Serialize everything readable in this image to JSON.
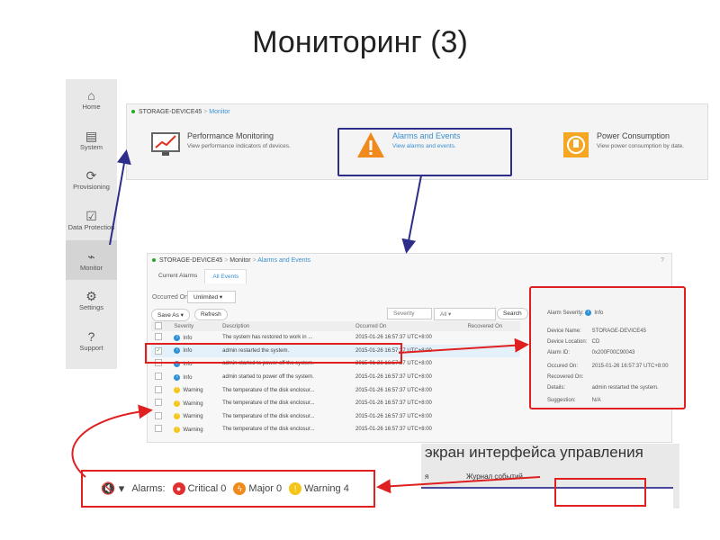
{
  "slide": {
    "title": "Мониторинг (3)"
  },
  "sidebar": {
    "items": [
      {
        "label": "Home",
        "icon": "⌂"
      },
      {
        "label": "System",
        "icon": "▤"
      },
      {
        "label": "Provisioning",
        "icon": "⟳"
      },
      {
        "label": "Data Protection",
        "icon": "☑"
      },
      {
        "label": "Monitor",
        "icon": "⌁"
      },
      {
        "label": "Settings",
        "icon": "⚙"
      },
      {
        "label": "Support",
        "icon": "?"
      }
    ]
  },
  "monitor": {
    "breadcrumb": {
      "device": "STORAGE-DEVICE45",
      "sep": ">",
      "current": "Monitor"
    },
    "cards": [
      {
        "title": "Performance Monitoring",
        "subtitle": "View performance indicators of devices."
      },
      {
        "title": "Alarms and Events",
        "subtitle": "View alarms and events."
      },
      {
        "title": "Power Consumption",
        "subtitle": "View power consumption by date."
      }
    ]
  },
  "events": {
    "breadcrumb": {
      "device": "STORAGE-DEVICE45",
      "monitor": "Monitor",
      "current": "Alarms and Events",
      "sep": ">"
    },
    "help": "?",
    "tabs": [
      "Current Alarms",
      "All Events"
    ],
    "occurred_label": "Occurred On:",
    "occurred_value": "Unlimited",
    "save_as": "Save As ▾",
    "refresh": "Refresh",
    "severity_label": "Severity",
    "severity_value": "All",
    "search": "Search",
    "columns": [
      "Severity",
      "Description",
      "Occurred On",
      "Recovered On"
    ],
    "rows": [
      {
        "severity": "Info",
        "description": "The system has restored to work in ...",
        "occurred": "2015-01-26 16:57:37 UTC+8:00",
        "checked": false
      },
      {
        "severity": "Info",
        "description": "admin restarted the system.",
        "occurred": "2015-01-26 16:57:37 UTC+8:00",
        "checked": true
      },
      {
        "severity": "Info",
        "description": "admin started to power off the system.",
        "occurred": "2015-01-26 16:57:37 UTC+8:00",
        "checked": false
      },
      {
        "severity": "Info",
        "description": "admin started to power off the system.",
        "occurred": "2015-01-26 16:57:37 UTC+8:00",
        "checked": false
      },
      {
        "severity": "Warning",
        "description": "The temperature of the disk enclosur...",
        "occurred": "2015-01-26 16:57:37 UTC+8:00",
        "checked": false
      },
      {
        "severity": "Warning",
        "description": "The temperature of the disk enclosur...",
        "occurred": "2015-01-26 16:57:37 UTC+8:00",
        "checked": false
      },
      {
        "severity": "Warning",
        "description": "The temperature of the disk enclosur...",
        "occurred": "2015-01-26 16:57:37 UTC+8:00",
        "checked": false
      },
      {
        "severity": "Warning",
        "description": "The temperature of the disk enclosur...",
        "occurred": "2015-01-26 16:57:37 UTC+8:00",
        "checked": false
      }
    ]
  },
  "detail": {
    "severity_label": "Alarm Severity:",
    "severity": "Info",
    "fields": [
      {
        "label": "Device Name:",
        "value": "STORAGE-DEVICE45"
      },
      {
        "label": "Device Location:",
        "value": "CD"
      },
      {
        "label": "Alarm ID:",
        "value": "0x200F00C90043"
      },
      {
        "label": "Occured On:",
        "value": "2015-01-26 16:57:37 UTC+8:00"
      },
      {
        "label": "Recovered On:",
        "value": ""
      },
      {
        "label": "Details:",
        "value": "admin restarted the system."
      },
      {
        "label": "Suggestion:",
        "value": "N/A"
      }
    ]
  },
  "alarm_bar": {
    "label": "Alarms:",
    "critical": "Critical 0",
    "major": "Major 0",
    "warning": "Warning 4"
  },
  "inset": {
    "heading": "экран интерфейса управления",
    "caption": "Журнал событий",
    "left_fragment": "я"
  },
  "colors": {
    "accent": "#3a8fd0",
    "highlight": "#e02020",
    "navy": "#2e2e8a",
    "warning": "#f5a623"
  }
}
